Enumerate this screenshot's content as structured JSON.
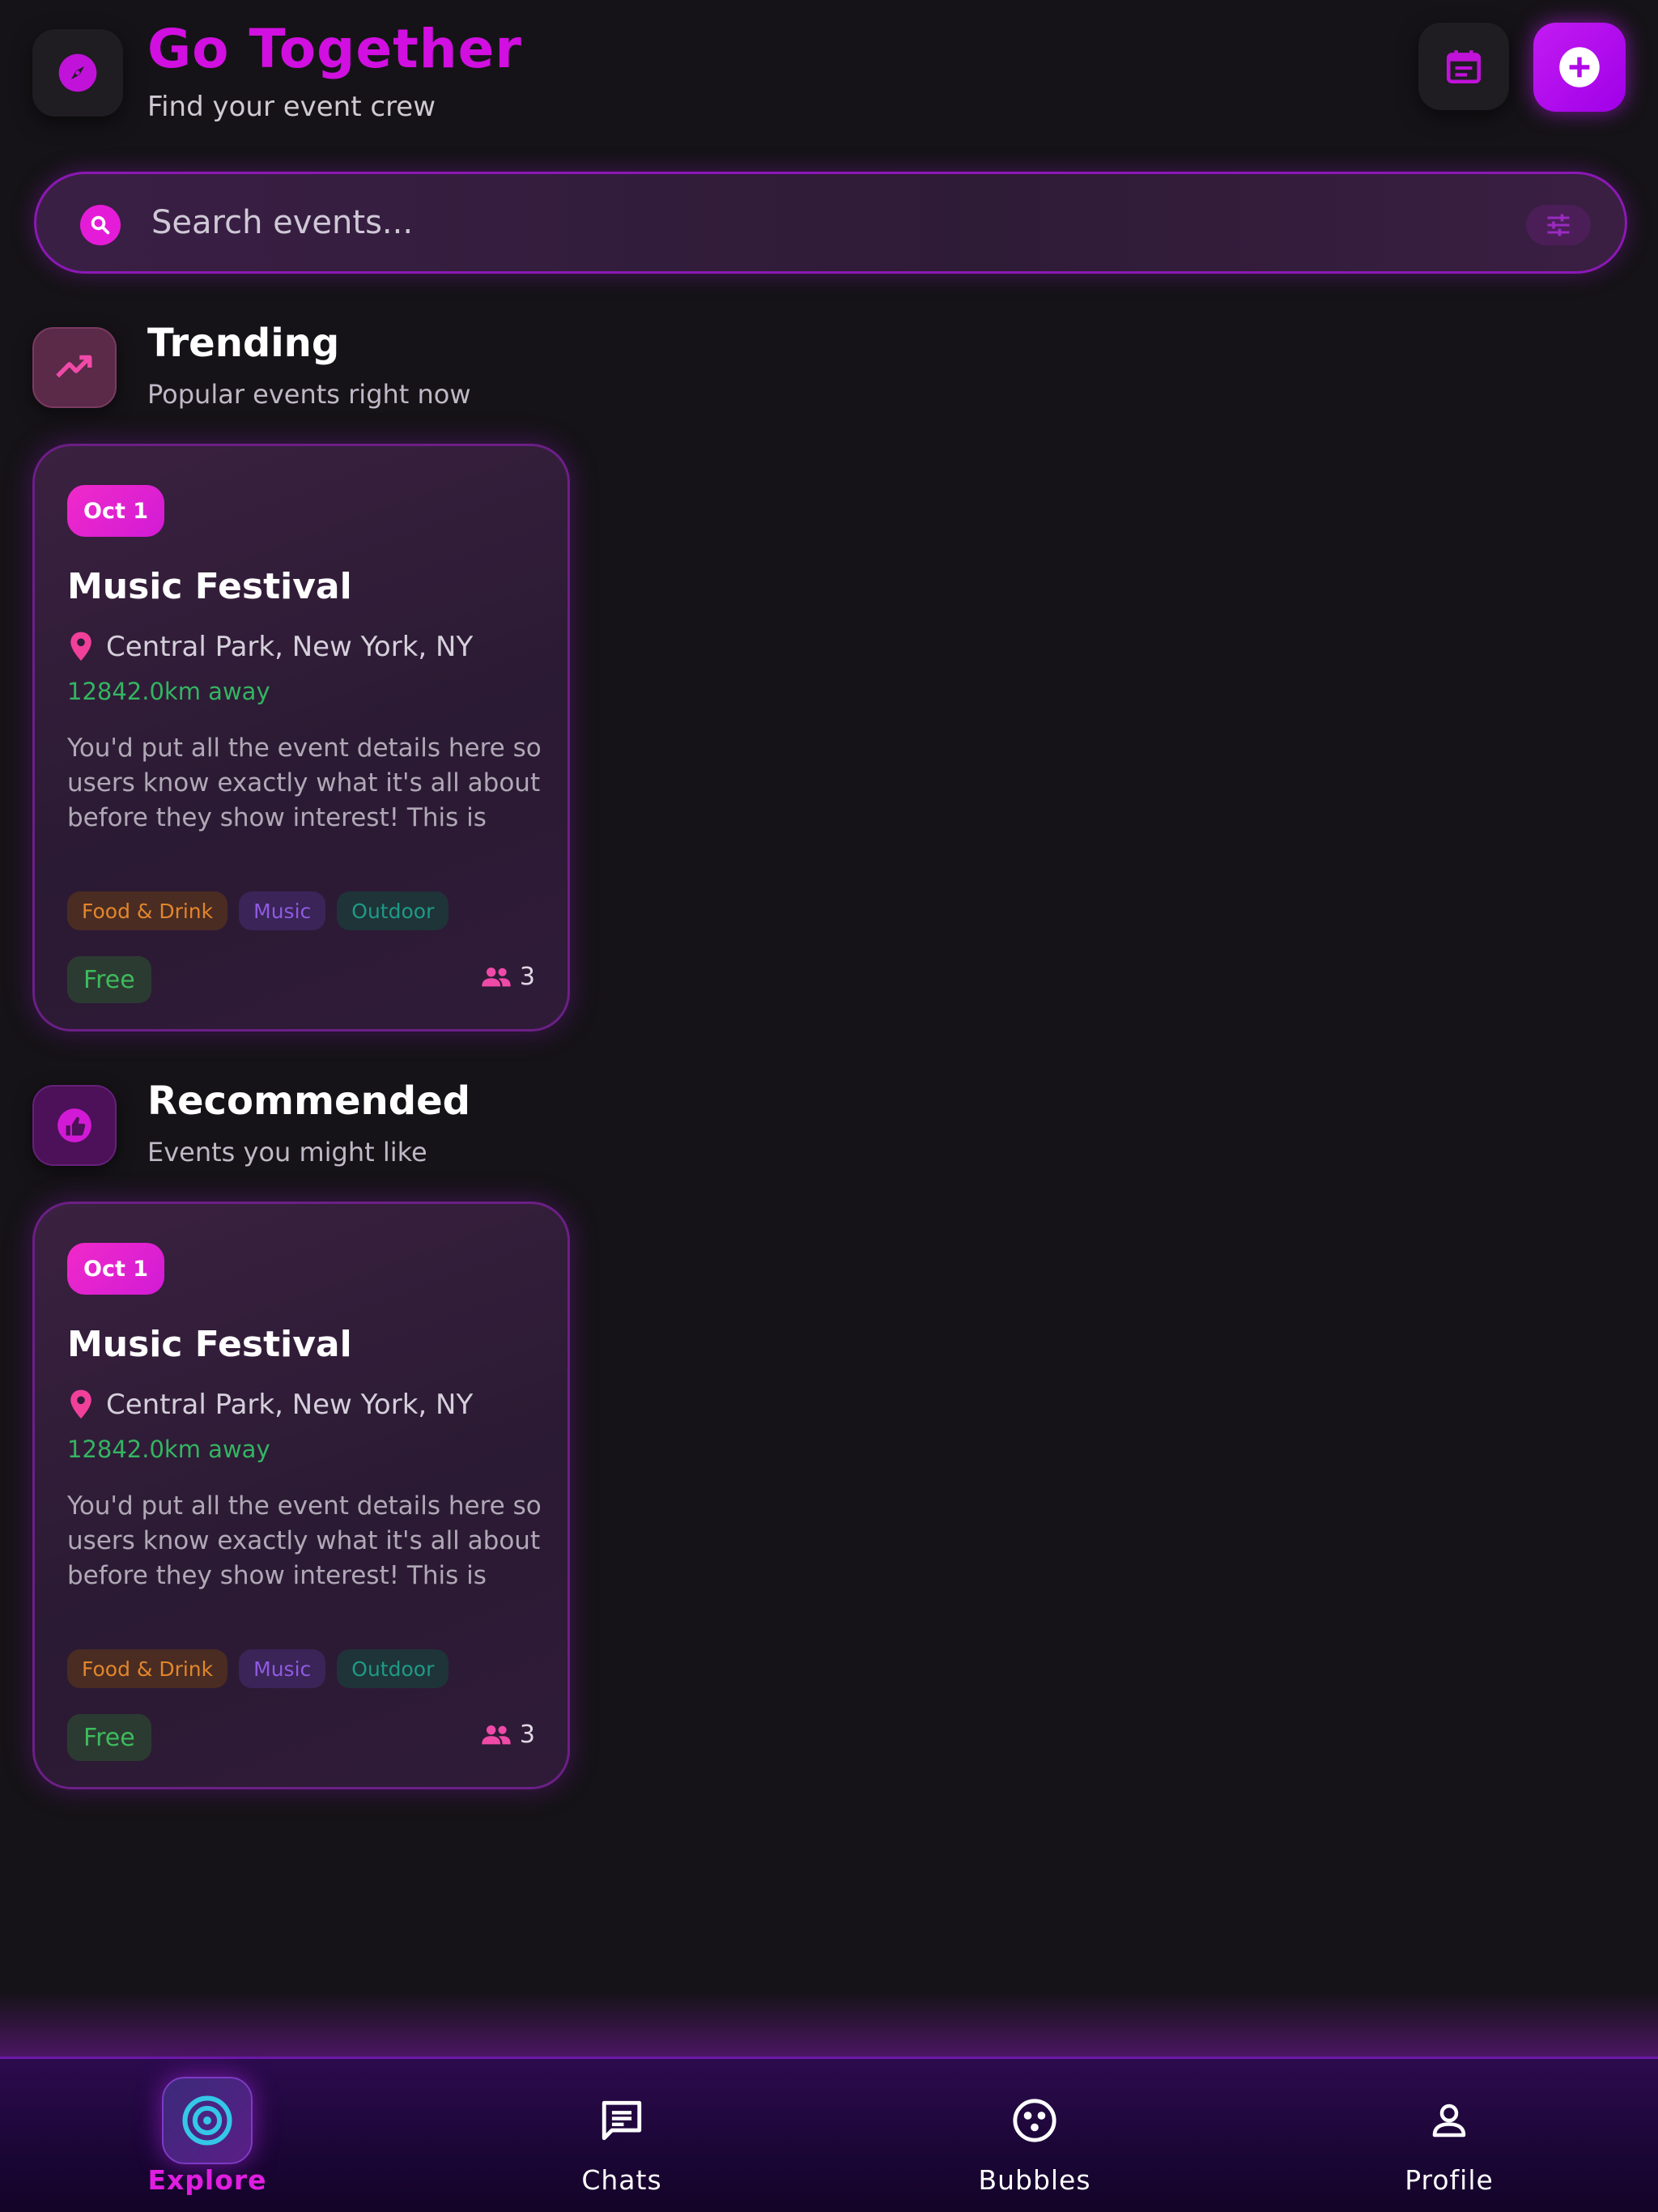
{
  "header": {
    "title": "Go Together",
    "subtitle": "Find your event crew"
  },
  "search": {
    "placeholder": "Search events..."
  },
  "sections": {
    "trending": {
      "title": "Trending",
      "subtitle": "Popular events right now"
    },
    "recommended": {
      "title": "Recommended",
      "subtitle": "Events you might like"
    }
  },
  "cards": [
    {
      "date": "Oct 1",
      "title": "Music Festival",
      "location": "Central Park, New York, NY",
      "distance": "12842.0km away",
      "description": "You'd put all the event details here so users know exactly what it's all about before they show interest! This is jus...",
      "tags": [
        "Food & Drink",
        "Music",
        "Outdoor"
      ],
      "price": "Free",
      "attendees": "3"
    },
    {
      "date": "Oct 1",
      "title": "Music Festival",
      "location": "Central Park, New York, NY",
      "distance": "12842.0km away",
      "description": "You'd put all the event details here so users know exactly what it's all about before they show interest! This is jus...",
      "tags": [
        "Food & Drink",
        "Music",
        "Outdoor"
      ],
      "price": "Free",
      "attendees": "3"
    }
  ],
  "nav": [
    {
      "label": "Explore",
      "icon": "target-icon",
      "active": true
    },
    {
      "label": "Chats",
      "icon": "chat-icon",
      "active": false
    },
    {
      "label": "Bubbles",
      "icon": "bubbles-icon",
      "active": false
    },
    {
      "label": "Profile",
      "icon": "person-icon",
      "active": false
    }
  ],
  "colors": {
    "accent": "#d10fe0",
    "background": "#151317",
    "distance": "#33b561",
    "nav_background": "#1b0636"
  }
}
